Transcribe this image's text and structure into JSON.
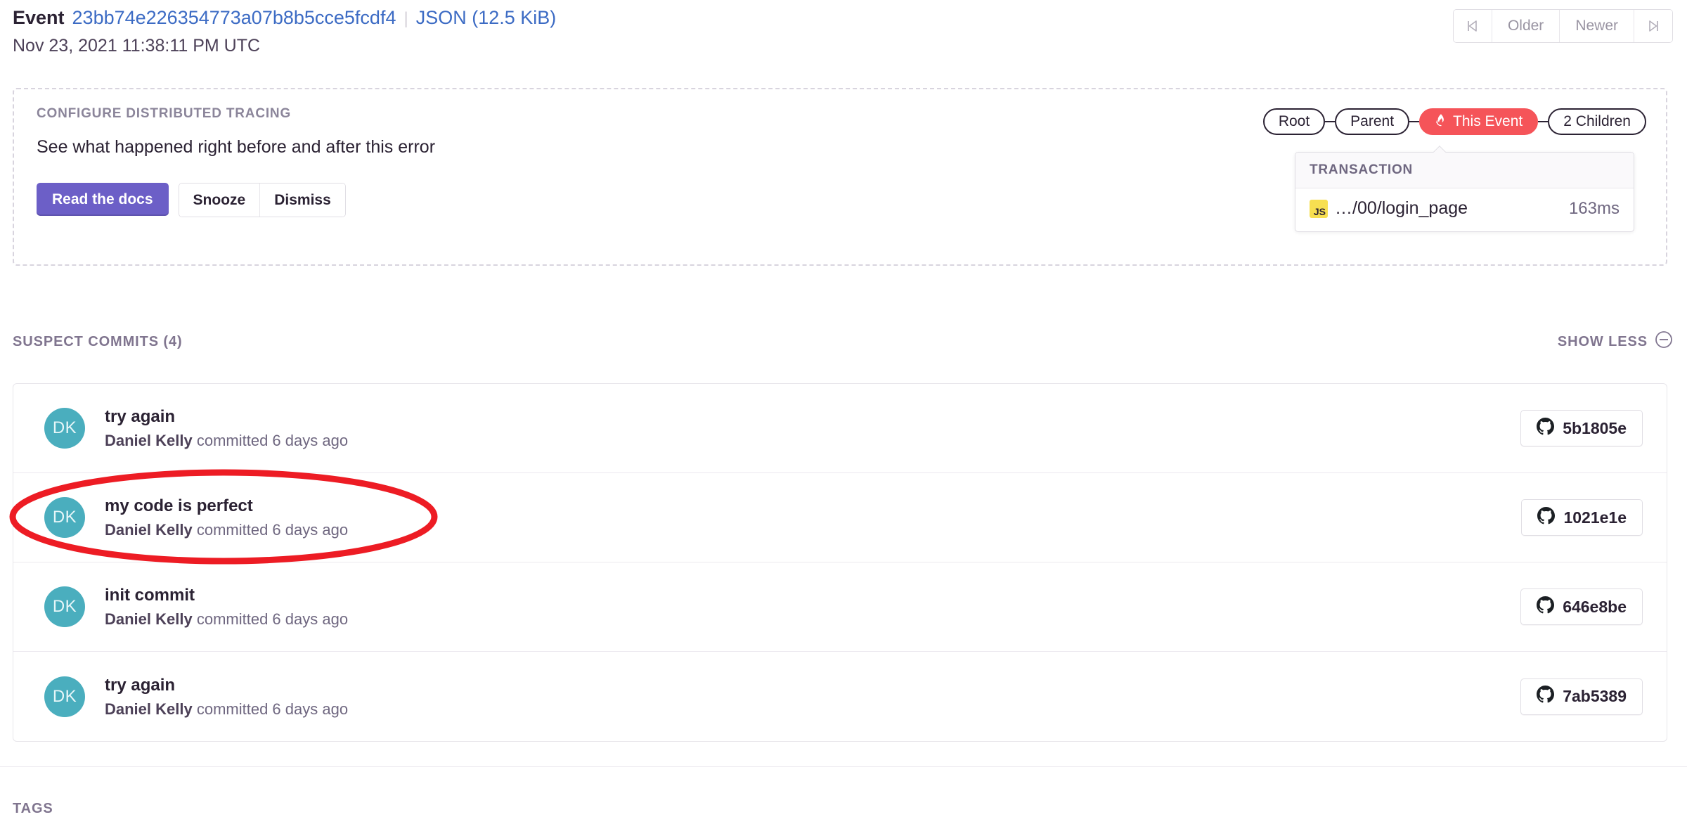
{
  "header": {
    "event_word": "Event",
    "event_id": "23bb74e226354773a07b8b5cce5fcdf4",
    "separator": "|",
    "json_link": "JSON (12.5 KiB)",
    "date": "Nov 23, 2021 11:38:11 PM UTC"
  },
  "pagination": {
    "first_icon": "first-page-icon",
    "older_label": "Older",
    "newer_label": "Newer",
    "last_icon": "last-page-icon"
  },
  "banner": {
    "kicker": "CONFIGURE DISTRIBUTED TRACING",
    "description": "See what happened right before and after this error",
    "primary_label": "Read the docs",
    "snooze_label": "Snooze",
    "dismiss_label": "Dismiss",
    "primary_color": "#6c5fc7"
  },
  "quicktrace": {
    "pills": [
      {
        "label": "Root",
        "current": false
      },
      {
        "label": "Parent",
        "current": false
      },
      {
        "label": "This Event",
        "current": true,
        "icon": "flame-icon"
      },
      {
        "label": "2 Children",
        "current": false
      }
    ],
    "current_color": "#f55459"
  },
  "transaction_tooltip": {
    "heading": "TRANSACTION",
    "platform_badge": "JS",
    "badge_color": "#f7df51",
    "name": "…/00/login_page",
    "duration": "163ms"
  },
  "suspect_commits": {
    "title": "SUSPECT COMMITS (4)",
    "show_less_label": "SHOW LESS",
    "show_less_icon": "circle-minus-icon",
    "rows": [
      {
        "avatar_initials": "DK",
        "message": "try again",
        "author": "Daniel Kelly",
        "meta_suffix": "committed 6 days ago",
        "hash": "5b1805e",
        "hash_icon": "github-icon"
      },
      {
        "avatar_initials": "DK",
        "message": "my code is perfect",
        "author": "Daniel Kelly",
        "meta_suffix": "committed 6 days ago",
        "hash": "1021e1e",
        "hash_icon": "github-icon"
      },
      {
        "avatar_initials": "DK",
        "message": "init commit",
        "author": "Daniel Kelly",
        "meta_suffix": "committed 6 days ago",
        "hash": "646e8be",
        "hash_icon": "github-icon"
      },
      {
        "avatar_initials": "DK",
        "message": "try again",
        "author": "Daniel Kelly",
        "meta_suffix": "committed 6 days ago",
        "hash": "7ab5389",
        "hash_icon": "github-icon"
      }
    ],
    "avatar_color": "#4aaebe"
  },
  "tags": {
    "title": "TAGS"
  },
  "annotation": {
    "shape": "red-ellipse-highlight",
    "color": "#ed1c24",
    "targets_row_index": 1
  }
}
